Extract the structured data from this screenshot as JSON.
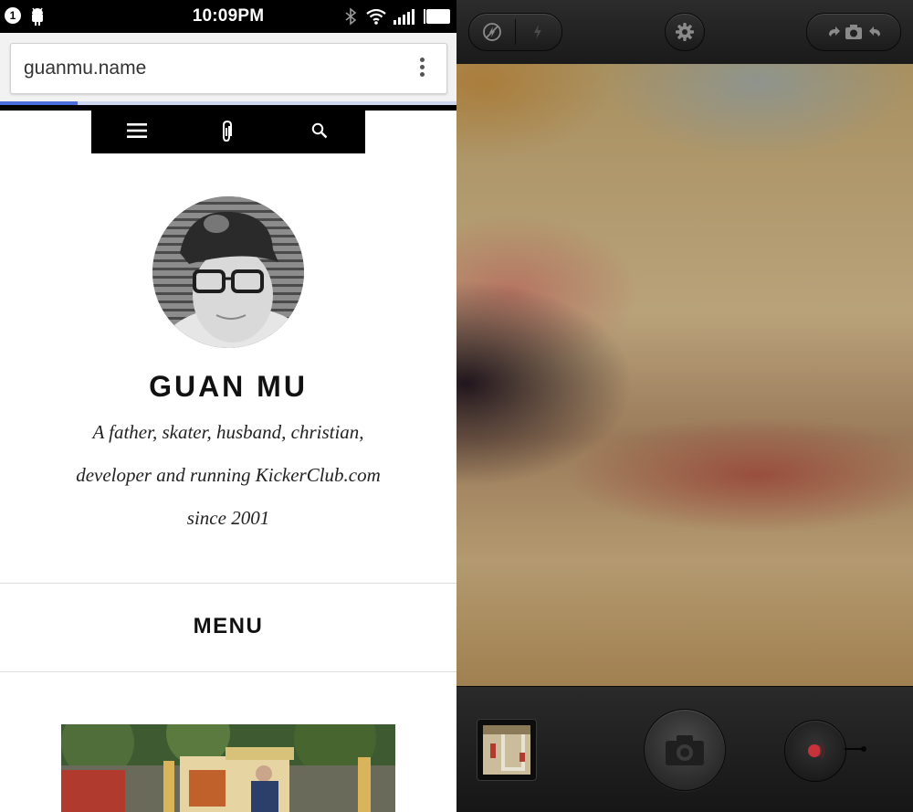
{
  "status_bar": {
    "notification_count": "1",
    "time": "10:09PM",
    "icons": [
      "android-icon",
      "bluetooth-icon",
      "wifi-icon",
      "signal-icon",
      "battery-icon"
    ]
  },
  "browser": {
    "url": "guanmu.name",
    "menu_icon": "overflow-menu-icon"
  },
  "site": {
    "nav_icons": [
      "hamburger-menu-icon",
      "paperclip-icon",
      "search-icon"
    ],
    "name": "GUAN MU",
    "tagline_lines": [
      "A father, skater, husband, christian,",
      "developer and running KickerClub.com",
      "since 2001"
    ],
    "menu_label": "MENU"
  },
  "camera": {
    "top_icons": [
      "flash-off-icon",
      "flash-on-icon",
      "gear-icon",
      "switch-camera-icon"
    ],
    "bottom_icons": [
      "gallery-thumbnail",
      "shutter-camera-icon",
      "video-record-icon"
    ],
    "accent_record": "#c8323a"
  },
  "colors": {
    "page_bg": "#ffffff",
    "nav_bg": "#000000",
    "text": "#111111",
    "progress": "#4a6fd8",
    "camera_chrome": "#1c1c1c"
  }
}
